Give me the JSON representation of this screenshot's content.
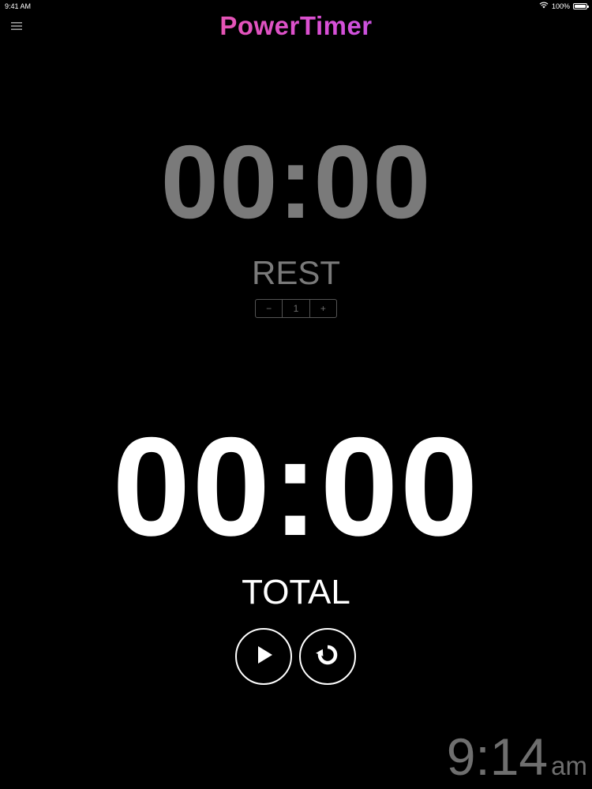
{
  "status_bar": {
    "time": "9:41 AM",
    "battery": "100%",
    "battery_level": 1.0
  },
  "header": {
    "title": "PowerTimer",
    "menu_icon": "hamburger-menu-icon",
    "title_gradient": [
      "#ff5f6d",
      "#d94fd6",
      "#7c5cff"
    ]
  },
  "rest": {
    "time": "00:00",
    "label": "REST",
    "stepper": {
      "minus": "−",
      "value": "1",
      "plus": "+"
    }
  },
  "total": {
    "time": "00:00",
    "label": "TOTAL"
  },
  "controls": {
    "play_icon": "play-icon",
    "reset_icon": "reset-icon"
  },
  "clock": {
    "time": "9:14",
    "ampm": "am"
  },
  "colors": {
    "background": "#000000",
    "dim_text": "#7a7a7a",
    "bright_text": "#ffffff"
  }
}
